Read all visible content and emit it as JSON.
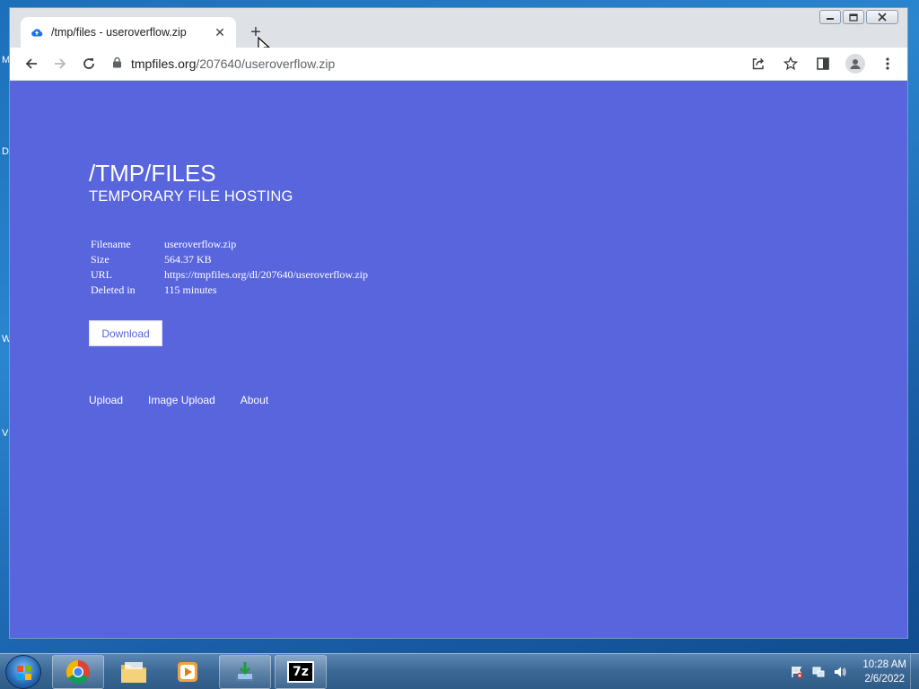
{
  "desktop": {
    "edge_letters": [
      "M",
      "D",
      "W",
      "V"
    ]
  },
  "browser": {
    "tab": {
      "title": "/tmp/files - useroverflow.zip",
      "favicon": "cloud-upload-icon"
    },
    "new_tab_icon": "+",
    "address": {
      "host": "tmpfiles.org",
      "path": "/207640/useroverflow.zip"
    }
  },
  "page": {
    "title": "/TMP/FILES",
    "subtitle": "TEMPORARY FILE HOSTING",
    "info": {
      "filename_label": "Filename",
      "filename": "useroverflow.zip",
      "size_label": "Size",
      "size": "564.37 KB",
      "url_label": "URL",
      "url": "https://tmpfiles.org/dl/207640/useroverflow.zip",
      "deleted_label": "Deleted in",
      "deleted": "115 minutes"
    },
    "download_button": "Download",
    "footer": {
      "upload": "Upload",
      "image_upload": "Image Upload",
      "about": "About"
    }
  },
  "taskbar": {
    "pinned": [
      "chrome-icon",
      "explorer-folder-icon",
      "media-player-icon",
      "installer-icon",
      "7zip-icon"
    ],
    "sevenzip_label": "7z",
    "clock": {
      "time": "10:28 AM",
      "date": "2/6/2022"
    }
  },
  "colors": {
    "page_bg": "#5865dc",
    "accent": "#5865dc"
  }
}
